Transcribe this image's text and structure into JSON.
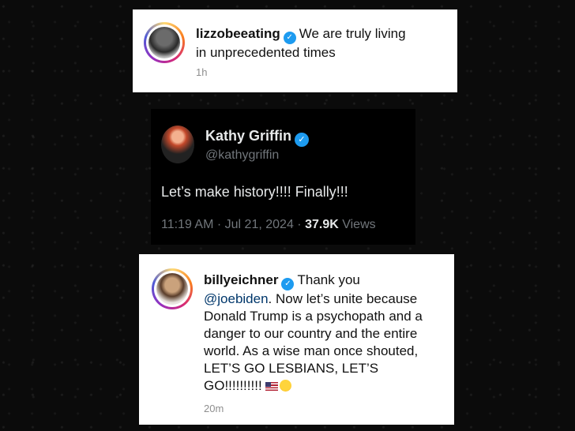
{
  "post1": {
    "username": "lizzobeeating",
    "verified_icon": "verified-badge-icon",
    "caption_line1": "We are truly living",
    "caption_line2": "in unprecedented times",
    "time": "1h"
  },
  "tweet": {
    "name": "Kathy Griffin",
    "handle": "@kathygriffin",
    "text": "Let’s make history!!!! Finally!!!",
    "time": "11:19 AM",
    "date": "Jul 21, 2024",
    "views_count": "37.9K",
    "views_label": "Views",
    "separator": "·"
  },
  "post3": {
    "username": "billyeichner",
    "verified_icon": "verified-badge-icon",
    "text_line1_rest": "Thank you",
    "mention": "@joebiden",
    "text_line2_rest": ". Now let’s unite because",
    "text_line3": "Donald Trump is a psychopath and a",
    "text_line4": "danger to our country and the entire",
    "text_line5": "world. As a wise man once shouted,",
    "text_line6": "LET’S GO LESBIANS, LET’S",
    "text_line7": "GO!!!!!!!!!!",
    "emojis": [
      "us-flag-icon",
      "party-face-icon"
    ],
    "time": "20m"
  },
  "colors": {
    "background": "#0b0b0b",
    "verified_blue": "#1d9bf0",
    "tweet_text": "#e7e9ea",
    "tweet_muted": "#71767b",
    "ig_muted": "#8e8e8e"
  }
}
